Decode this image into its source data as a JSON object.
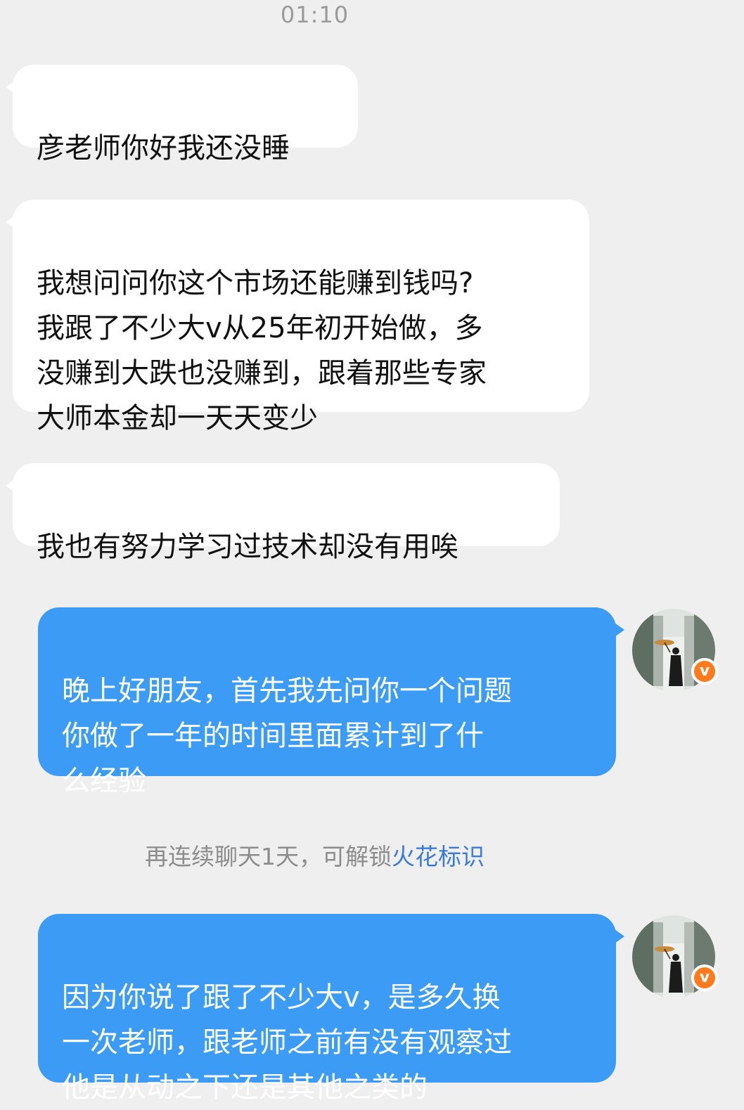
{
  "timestamp": "01:10",
  "messages": [
    {
      "text": "彦老师你好我还没睡"
    },
    {
      "text": "我想问问你这个市场还能赚到钱吗?\n我跟了不少大v从25年初开始做，多\n没赚到大跌也没赚到，跟着那些专家\n大师本金却一天天变少"
    },
    {
      "text": "我也有努力学习过技术却没有用唉"
    },
    {
      "text": "晚上好朋友，首先我先问你一个问题\n你做了一年的时间里面累计到了什\n么经验"
    },
    {
      "text": "因为你说了跟了不少大v，是多久换\n一次老师，跟老师之前有没有观察过\n他是从动之下还是其他之类的"
    }
  ],
  "system_note": {
    "text": "再连续聊天1天，可解锁",
    "link": "火花标识"
  },
  "avatar_badge": "v",
  "colors": {
    "background": "#efefef",
    "incoming_bubble": "#ffffff",
    "outgoing_bubble": "#3b9bf5",
    "badge": "#ff7a1a",
    "link": "#3b7bd8"
  },
  "icons": {
    "avatar": "person-with-umbrella-avatar",
    "badge": "verified-v-badge"
  }
}
